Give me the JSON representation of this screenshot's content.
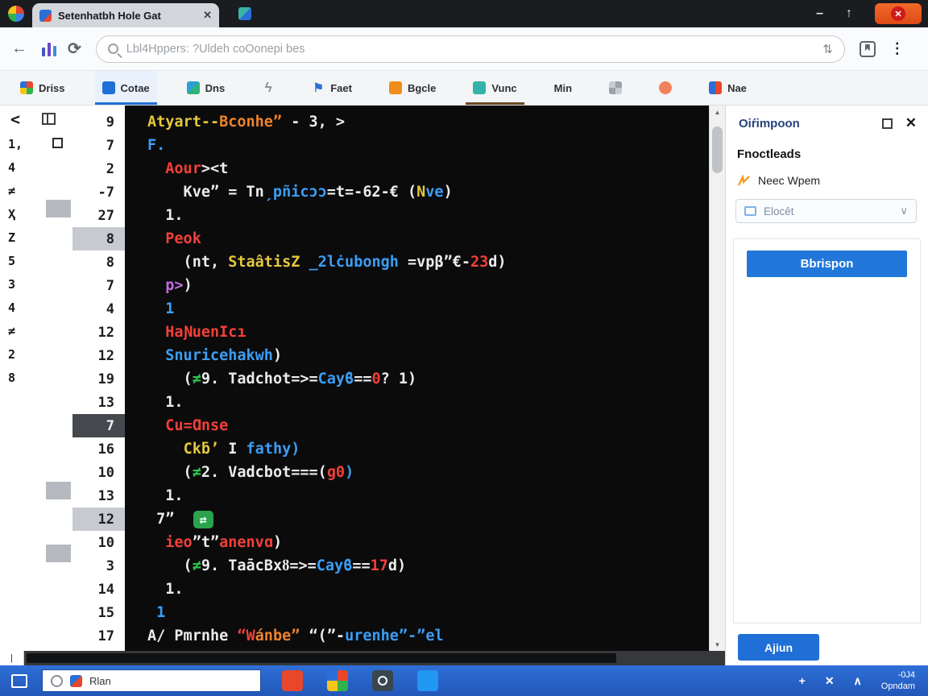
{
  "colors": {
    "accent_blue": "#2176d9",
    "taskbar_blue": "#2a67d3",
    "code_background": "#0b0b0c",
    "code_red": "#f34038",
    "code_blue": "#3b9ef5",
    "code_yellow": "#e5c83d",
    "code_green": "#2fc24d",
    "badge_green": "#2aa34c"
  },
  "icons": {
    "tab_close": "✕",
    "minimize": "–",
    "maximize": "↑",
    "close_x": "✕",
    "back": "←",
    "refresh": "⟳",
    "sort": "⇅",
    "menu": "⋮",
    "back_chevron": "<",
    "scroll_up": "▲",
    "scroll_down": "▼",
    "hbar": "|",
    "caret_down": "∨",
    "panel_close": "✕",
    "bolt": "ϟ",
    "flag": "⚑"
  },
  "tabbar": {
    "tab_title": "Setenhatbh Hole Gat"
  },
  "navbar": {
    "url_text": "Lbl4Hppers: ?Uldeh coOonepi bes"
  },
  "bookmarks": [
    {
      "label": "Driss",
      "type": "grid"
    },
    {
      "label": "Cotae",
      "type": "blue",
      "active": true
    },
    {
      "label": "Dns",
      "type": "teal2"
    },
    {
      "label": "",
      "type": "bolt"
    },
    {
      "label": "Faet",
      "type": "flag"
    },
    {
      "label": "Bgcle",
      "type": "orange"
    },
    {
      "label": "Vunc",
      "type": "teal",
      "underline": true
    },
    {
      "label": "Min",
      "type": "none"
    },
    {
      "label": "",
      "type": "gray-grid"
    },
    {
      "label": "",
      "type": "peach"
    },
    {
      "label": "Nae",
      "type": "duo"
    }
  ],
  "editor": {
    "marks": [
      "1,",
      "4",
      "≠",
      "Ҳ",
      "Z",
      "5",
      "3",
      "4",
      "≠",
      "2",
      "8"
    ],
    "lines": [
      {
        "num": "9",
        "segs": [
          [
            "y",
            "Atyart--"
          ],
          [
            "o",
            "Bconhe”"
          ],
          [
            "w",
            " - 3, >"
          ]
        ]
      },
      {
        "num": "7",
        "segs": [
          [
            "b",
            "F."
          ]
        ]
      },
      {
        "num": "2",
        "segs": [
          [
            "w",
            "  "
          ],
          [
            "r",
            "Aour"
          ],
          [
            "w",
            "><t"
          ]
        ]
      },
      {
        "num": "-7",
        "segs": [
          [
            "w",
            "    Kve” = Tn"
          ],
          [
            "b",
            "ˏpñicɔɔ"
          ],
          [
            "w",
            "=t=-62-€ ("
          ],
          [
            "y",
            "N"
          ],
          [
            "b",
            "ve"
          ],
          [
            "w",
            ")"
          ]
        ]
      },
      {
        "num": "27",
        "segs": [
          [
            "w",
            "  1."
          ]
        ]
      },
      {
        "num": "8",
        "hl": "gray",
        "segs": [
          [
            "r",
            "  Peok"
          ]
        ]
      },
      {
        "num": "8",
        "segs": [
          [
            "w",
            "    (nt, "
          ],
          [
            "y",
            "StaâtisZ "
          ],
          [
            "b",
            "_2lċubongh "
          ],
          [
            "w",
            "=vpβ”€-"
          ],
          [
            "r",
            "23"
          ],
          [
            "w",
            "d)"
          ]
        ]
      },
      {
        "num": "7",
        "segs": [
          [
            "m",
            "  p>"
          ],
          [
            "w",
            ")"
          ]
        ]
      },
      {
        "num": "4",
        "segs": [
          [
            "b",
            "  1"
          ]
        ]
      },
      {
        "num": "12",
        "segs": [
          [
            "r",
            "  HaƝuenIcı"
          ]
        ]
      },
      {
        "num": "12",
        "segs": [
          [
            "b",
            "  Snuricehakwh"
          ],
          [
            "w",
            ")"
          ]
        ]
      },
      {
        "num": "19",
        "segs": [
          [
            "w",
            "    ("
          ],
          [
            "g",
            "≠"
          ],
          [
            "w",
            "9. Tadchot=>="
          ],
          [
            "b",
            "Cayϐ"
          ],
          [
            "w",
            "=="
          ],
          [
            "r",
            "0"
          ],
          [
            "w",
            "? 1)"
          ]
        ]
      },
      {
        "num": "13",
        "segs": [
          [
            "w",
            "  1."
          ]
        ]
      },
      {
        "num": "7",
        "hl": "dark",
        "segs": [
          [
            "r",
            "  Cu=Ɑnse"
          ]
        ]
      },
      {
        "num": "16",
        "segs": [
          [
            "w",
            "    "
          ],
          [
            "y",
            "Ckƃ’ "
          ],
          [
            "w",
            "I "
          ],
          [
            "b",
            "fathy)"
          ]
        ]
      },
      {
        "num": "10",
        "segs": [
          [
            "w",
            "    ("
          ],
          [
            "g",
            "≠"
          ],
          [
            "w",
            "2. Vadcbot===("
          ],
          [
            "r",
            "ɡ0"
          ],
          [
            "b",
            ")"
          ]
        ]
      },
      {
        "num": "13",
        "segs": [
          [
            "w",
            "  1."
          ]
        ]
      },
      {
        "num": "12",
        "hl": "gray",
        "segs": [
          [
            "w",
            " 7” "
          ],
          [
            "badge",
            "⇄"
          ]
        ]
      },
      {
        "num": "10",
        "segs": [
          [
            "r",
            "  ieo"
          ],
          [
            "w",
            "”t”"
          ],
          [
            "r",
            "anenvɑ"
          ],
          [
            "w",
            ")"
          ]
        ]
      },
      {
        "num": "3",
        "segs": [
          [
            "w",
            "    ("
          ],
          [
            "g",
            "≠"
          ],
          [
            "w",
            "9. TaācBxȣ=>="
          ],
          [
            "b",
            "Cayϐ"
          ],
          [
            "w",
            "=="
          ],
          [
            "r",
            "17"
          ],
          [
            "w",
            "d)"
          ]
        ]
      },
      {
        "num": "14",
        "segs": [
          [
            "w",
            "  1."
          ]
        ]
      },
      {
        "num": "15",
        "segs": [
          [
            "b",
            " 1"
          ]
        ]
      },
      {
        "num": "17",
        "segs": [
          [
            "w",
            "A/ Pmrnhe "
          ],
          [
            "r",
            "“W"
          ],
          [
            "o",
            "ánbe”"
          ],
          [
            "w",
            " “(”-"
          ],
          [
            "b",
            "urenhe”-”el"
          ]
        ]
      }
    ]
  },
  "panel": {
    "title": "Oiŕimpoon",
    "section": "Fnoctleads",
    "link_label": "Neec Wpem",
    "dropdown_value": "Elocêt",
    "primary_button": "Bbrispon",
    "run_button": "Ajiun"
  },
  "taskbar": {
    "search_text": "Rlan",
    "apps": [
      "office",
      "grid",
      "camera",
      "blue"
    ],
    "buttons": [
      {
        "glyph": "+",
        "name": "plus-icon"
      },
      {
        "glyph": "✕",
        "name": "close-icon"
      },
      {
        "glyph": "∧",
        "name": "chevron-up-icon"
      }
    ],
    "tray_top": "-0J4",
    "tray_bottom": "Opndam"
  }
}
